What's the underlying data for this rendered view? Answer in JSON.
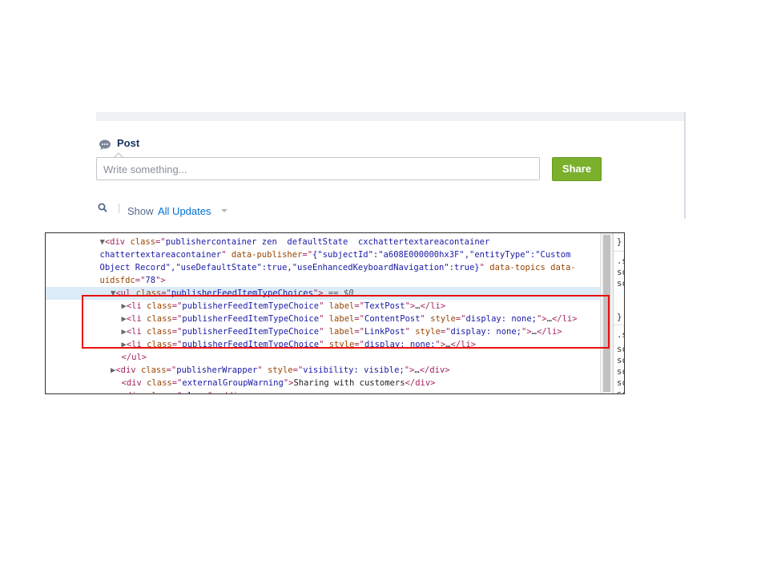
{
  "publisher": {
    "tab_label": "Post",
    "input_placeholder": "Write something...",
    "share_label": "Share",
    "filter_show": "Show",
    "filter_value": "All Updates",
    "colors": {
      "share": "#7ab02c",
      "link": "#0070d2"
    }
  },
  "devtools": {
    "lines": [
      {
        "indent": 5,
        "tokens": [
          {
            "t": "tri",
            "v": "▼"
          },
          {
            "t": "tag",
            "v": "<div "
          },
          {
            "t": "attr",
            "v": "class"
          },
          {
            "t": "tag",
            "v": "=\""
          },
          {
            "t": "val",
            "v": "publishercontainer zen  defaultState  cxchattertextareacontainer"
          }
        ]
      },
      {
        "indent": 5,
        "tokens": [
          {
            "t": "val",
            "v": "chattertextareacontainer"
          },
          {
            "t": "tag",
            "v": "\" "
          },
          {
            "t": "attr",
            "v": "data-publisher"
          },
          {
            "t": "tag",
            "v": "=\""
          },
          {
            "t": "val",
            "v": "{\"subjectId\":\"a608E000000hx3F\",\"entityType\":\"Custom"
          }
        ]
      },
      {
        "indent": 5,
        "tokens": [
          {
            "t": "val",
            "v": "Object Record\",\"useDefaultState\":true,\"useEnhancedKeyboardNavigation\":true}"
          },
          {
            "t": "tag",
            "v": "\" "
          },
          {
            "t": "attr",
            "v": "data-topics data-"
          }
        ]
      },
      {
        "indent": 5,
        "tokens": [
          {
            "t": "attr",
            "v": "uidsfdc"
          },
          {
            "t": "tag",
            "v": "=\""
          },
          {
            "t": "val",
            "v": "78"
          },
          {
            "t": "tag",
            "v": "\">"
          }
        ]
      },
      {
        "indent": 6,
        "selected": true,
        "tokens": [
          {
            "t": "tri",
            "v": "▼"
          },
          {
            "t": "tag",
            "v": "<ul "
          },
          {
            "t": "attr",
            "v": "class"
          },
          {
            "t": "tag",
            "v": "=\""
          },
          {
            "t": "val",
            "v": "publisherFeedItemTypeChoices"
          },
          {
            "t": "tag",
            "v": "\">"
          },
          {
            "t": "dollar",
            "v": " == $0"
          }
        ]
      },
      {
        "indent": 7,
        "tokens": [
          {
            "t": "tri",
            "v": "▶"
          },
          {
            "t": "tag",
            "v": "<li "
          },
          {
            "t": "attr",
            "v": "class"
          },
          {
            "t": "tag",
            "v": "=\""
          },
          {
            "t": "val",
            "v": "publisherFeedItemTypeChoice"
          },
          {
            "t": "tag",
            "v": "\" "
          },
          {
            "t": "attr",
            "v": "label"
          },
          {
            "t": "tag",
            "v": "=\""
          },
          {
            "t": "val",
            "v": "TextPost"
          },
          {
            "t": "tag",
            "v": "\">"
          },
          {
            "t": "txt",
            "v": "…"
          },
          {
            "t": "tag",
            "v": "</li>"
          }
        ]
      },
      {
        "indent": 7,
        "tokens": [
          {
            "t": "tri",
            "v": "▶"
          },
          {
            "t": "tag",
            "v": "<li "
          },
          {
            "t": "attr",
            "v": "class"
          },
          {
            "t": "tag",
            "v": "=\""
          },
          {
            "t": "val",
            "v": "publisherFeedItemTypeChoice"
          },
          {
            "t": "tag",
            "v": "\" "
          },
          {
            "t": "attr",
            "v": "label"
          },
          {
            "t": "tag",
            "v": "=\""
          },
          {
            "t": "val",
            "v": "ContentPost"
          },
          {
            "t": "tag",
            "v": "\" "
          },
          {
            "t": "attr",
            "v": "style"
          },
          {
            "t": "tag",
            "v": "=\""
          },
          {
            "t": "val",
            "v": "display: none;"
          },
          {
            "t": "tag",
            "v": "\">"
          },
          {
            "t": "txt",
            "v": "…"
          },
          {
            "t": "tag",
            "v": "</li>"
          }
        ]
      },
      {
        "indent": 7,
        "tokens": [
          {
            "t": "tri",
            "v": "▶"
          },
          {
            "t": "tag",
            "v": "<li "
          },
          {
            "t": "attr",
            "v": "class"
          },
          {
            "t": "tag",
            "v": "=\""
          },
          {
            "t": "val",
            "v": "publisherFeedItemTypeChoice"
          },
          {
            "t": "tag",
            "v": "\" "
          },
          {
            "t": "attr",
            "v": "label"
          },
          {
            "t": "tag",
            "v": "=\""
          },
          {
            "t": "val",
            "v": "LinkPost"
          },
          {
            "t": "tag",
            "v": "\" "
          },
          {
            "t": "attr",
            "v": "style"
          },
          {
            "t": "tag",
            "v": "=\""
          },
          {
            "t": "val",
            "v": "display: none;"
          },
          {
            "t": "tag",
            "v": "\">"
          },
          {
            "t": "txt",
            "v": "…"
          },
          {
            "t": "tag",
            "v": "</li>"
          }
        ]
      },
      {
        "indent": 7,
        "tokens": [
          {
            "t": "tri",
            "v": "▶"
          },
          {
            "t": "tag",
            "v": "<li "
          },
          {
            "t": "attr",
            "v": "class"
          },
          {
            "t": "tag",
            "v": "=\""
          },
          {
            "t": "val",
            "v": "publisherFeedItemTypeChoice"
          },
          {
            "t": "tag",
            "v": "\" "
          },
          {
            "t": "attr",
            "v": "style"
          },
          {
            "t": "tag",
            "v": "=\""
          },
          {
            "t": "val",
            "v": "display: none;"
          },
          {
            "t": "tag",
            "v": "\">"
          },
          {
            "t": "txt",
            "v": "…"
          },
          {
            "t": "tag",
            "v": "</li>"
          }
        ]
      },
      {
        "indent": 7,
        "tokens": [
          {
            "t": "tag",
            "v": "</ul>"
          }
        ]
      },
      {
        "indent": 6,
        "tokens": [
          {
            "t": "tri",
            "v": "▶"
          },
          {
            "t": "tag",
            "v": "<div "
          },
          {
            "t": "attr",
            "v": "class"
          },
          {
            "t": "tag",
            "v": "=\""
          },
          {
            "t": "val",
            "v": "publisherWrapper"
          },
          {
            "t": "tag",
            "v": "\" "
          },
          {
            "t": "attr",
            "v": "style"
          },
          {
            "t": "tag",
            "v": "=\""
          },
          {
            "t": "val",
            "v": "visibility: visible;"
          },
          {
            "t": "tag",
            "v": "\">"
          },
          {
            "t": "txt",
            "v": "…"
          },
          {
            "t": "tag",
            "v": "</div>"
          }
        ]
      },
      {
        "indent": 7,
        "tokens": [
          {
            "t": "tag",
            "v": "<div "
          },
          {
            "t": "attr",
            "v": "class"
          },
          {
            "t": "tag",
            "v": "=\""
          },
          {
            "t": "val",
            "v": "externalGroupWarning"
          },
          {
            "t": "tag",
            "v": "\">"
          },
          {
            "t": "txt",
            "v": "Sharing with customers"
          },
          {
            "t": "tag",
            "v": "</div>"
          }
        ]
      },
      {
        "indent": 7,
        "tokens": [
          {
            "t": "tag",
            "v": "<div "
          },
          {
            "t": "attr",
            "v": "class"
          },
          {
            "t": "tag",
            "v": "=\""
          },
          {
            "t": "val",
            "v": "clear"
          },
          {
            "t": "tag",
            "v": "\">"
          },
          {
            "t": "tag",
            "v": "</div>"
          }
        ]
      }
    ],
    "styles_fragments": [
      "}",
      ".s",
      "sc",
      "sc",
      "}",
      ".s",
      "sc",
      "sc",
      "sc",
      "sc",
      "sc",
      "sc"
    ]
  }
}
